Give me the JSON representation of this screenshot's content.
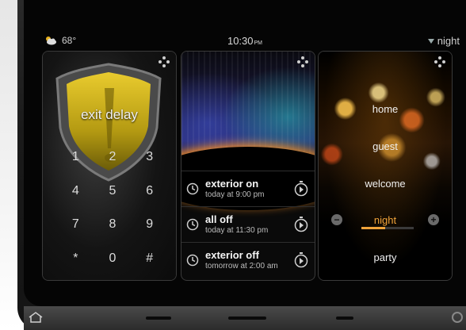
{
  "status_bar": {
    "weather_icon": "cloud-sun-icon",
    "temperature": "68°",
    "time": "10:30",
    "ampm": "PM",
    "mode": "night"
  },
  "security_panel": {
    "title": "exit delay",
    "keys": [
      "1",
      "2",
      "3",
      "4",
      "5",
      "6",
      "7",
      "8",
      "9",
      "*",
      "0",
      "#"
    ]
  },
  "schedule_panel": {
    "items": [
      {
        "title": "exterior on",
        "subtitle": "today at 9:00 pm"
      },
      {
        "title": "all off",
        "subtitle": "today at 11:30 pm"
      },
      {
        "title": "exterior off",
        "subtitle": "tomorrow at 2:00 am"
      }
    ]
  },
  "scenes_panel": {
    "scenes": [
      "home",
      "guest",
      "welcome",
      "night",
      "party"
    ],
    "active_scene": "night",
    "active_level": 0.45,
    "accent_color": "#f0a33a"
  }
}
